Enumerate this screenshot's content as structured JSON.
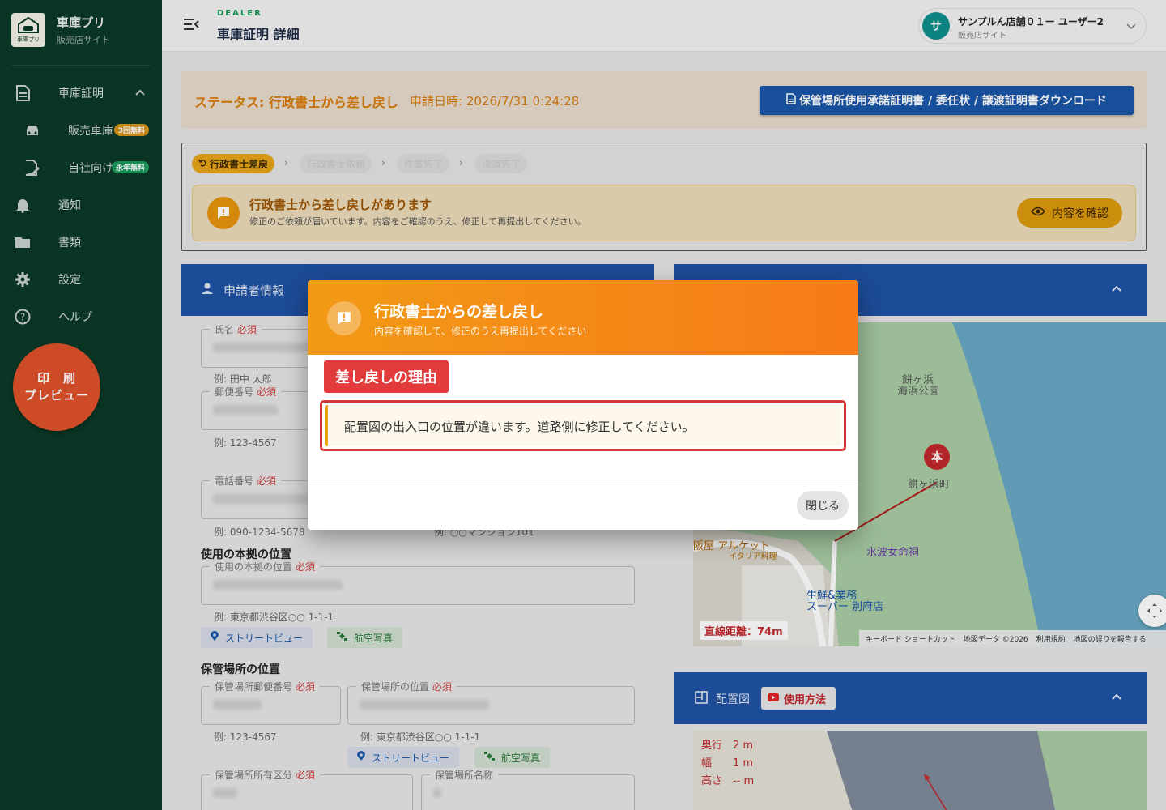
{
  "sidebar": {
    "logo_text": "車庫プリ",
    "brand_title": "車庫プリ",
    "brand_sub": "販売店サイト",
    "items": [
      {
        "label": "車庫証明",
        "icon": "document-icon"
      },
      {
        "label": "販売車庫",
        "icon": "car-icon",
        "badge": "3回無料"
      },
      {
        "label": "自社向け",
        "icon": "edit-doc-icon",
        "badge": "永年無料"
      },
      {
        "label": "通知",
        "icon": "bell-icon"
      },
      {
        "label": "書類",
        "icon": "folder-icon"
      },
      {
        "label": "設定",
        "icon": "gear-icon"
      },
      {
        "label": "ヘルプ",
        "icon": "help-icon"
      }
    ],
    "print_line1": "印　刷",
    "print_line2": "プレビュー"
  },
  "header": {
    "dealer": "DEALER",
    "title": "車庫証明 詳細",
    "user_initial": "サ",
    "user_name": "サンプルん店舗０１ー ユーザー2",
    "user_sub": "販売店サイト"
  },
  "status": {
    "status_text": "ステータス: 行政書士から差し戻し",
    "date_text": "申請日時: 2026/7/31 0:24:28",
    "download_label": "保管場所使用承諾証明書 / 委任状 / 譲渡証明書ダウンロード"
  },
  "steps": {
    "items": [
      "行政書士差戻",
      "行政書士依頼",
      "作業完了",
      "決済完了"
    ],
    "notice_title": "行政書士から差し戻しがあります",
    "notice_sub": "修正のご依頼が届いています。内容をご確認のうえ、修正して再提出してください。",
    "confirm_label": "内容を確認"
  },
  "applicant": {
    "title": "申請者情報",
    "required": "必須",
    "name_label": "氏名",
    "name_hint": "例: 田中 太郎",
    "postal_label": "郵便番号",
    "postal_hint": "例: 123-4567",
    "phone_label": "電話番号",
    "phone_hint": "例: 090-1234-5678",
    "address_hint2": "例: ○○マンション101",
    "base_section": "使用の本拠の位置",
    "base_label": "使用の本拠の位置",
    "base_hint": "例: 東京都渋谷区○○ 1-1-1",
    "streetview": "ストリートビュー",
    "aerial": "航空写真",
    "storage_section": "保管場所の位置",
    "storage_postal_label": "保管場所郵便番号",
    "storage_pos_label": "保管場所の位置",
    "storage_postal_hint": "例: 123-4567",
    "storage_pos_hint": "例: 東京都渋谷区○○ 1-1-1",
    "ownership_label": "保管場所所有区分",
    "storage_name_label": "保管場所名称"
  },
  "map": {
    "label_park1": "餅ヶ浜",
    "label_park2": "海浜公園",
    "label_town": "餅ヶ浜町",
    "label_shop": "阪屋 アルケット",
    "label_shop_sub": "イタリア料理",
    "label_shrine": "水波女命祠",
    "label_super1": "生鮮&業務",
    "label_super2": "スーパー 別府店",
    "pin_text": "本",
    "distance": "直線距離：74m",
    "footer": [
      "キーボード ショートカット",
      "地図データ ©2026",
      "利用規約",
      "地図の誤りを報告する"
    ]
  },
  "layout": {
    "title": "配置図",
    "usage_label": "使用方法",
    "depth": "奥行　2 m",
    "width": "幅　　1 m",
    "height": "高さ　-- m"
  },
  "dialog": {
    "title": "行政書士からの差し戻し",
    "subtitle": "内容を確認して、修正のうえ再提出してください",
    "reason_tag": "差し戻しの理由",
    "reason_text": "配置図の出入口の位置が違います。道路側に修正してください。",
    "close_label": "閉じる"
  },
  "colors": {
    "sidebar": "#0b3a28",
    "card_header": "#1f52a4",
    "accent_orange": "#f29a16",
    "alert_red": "#e13b3b"
  }
}
